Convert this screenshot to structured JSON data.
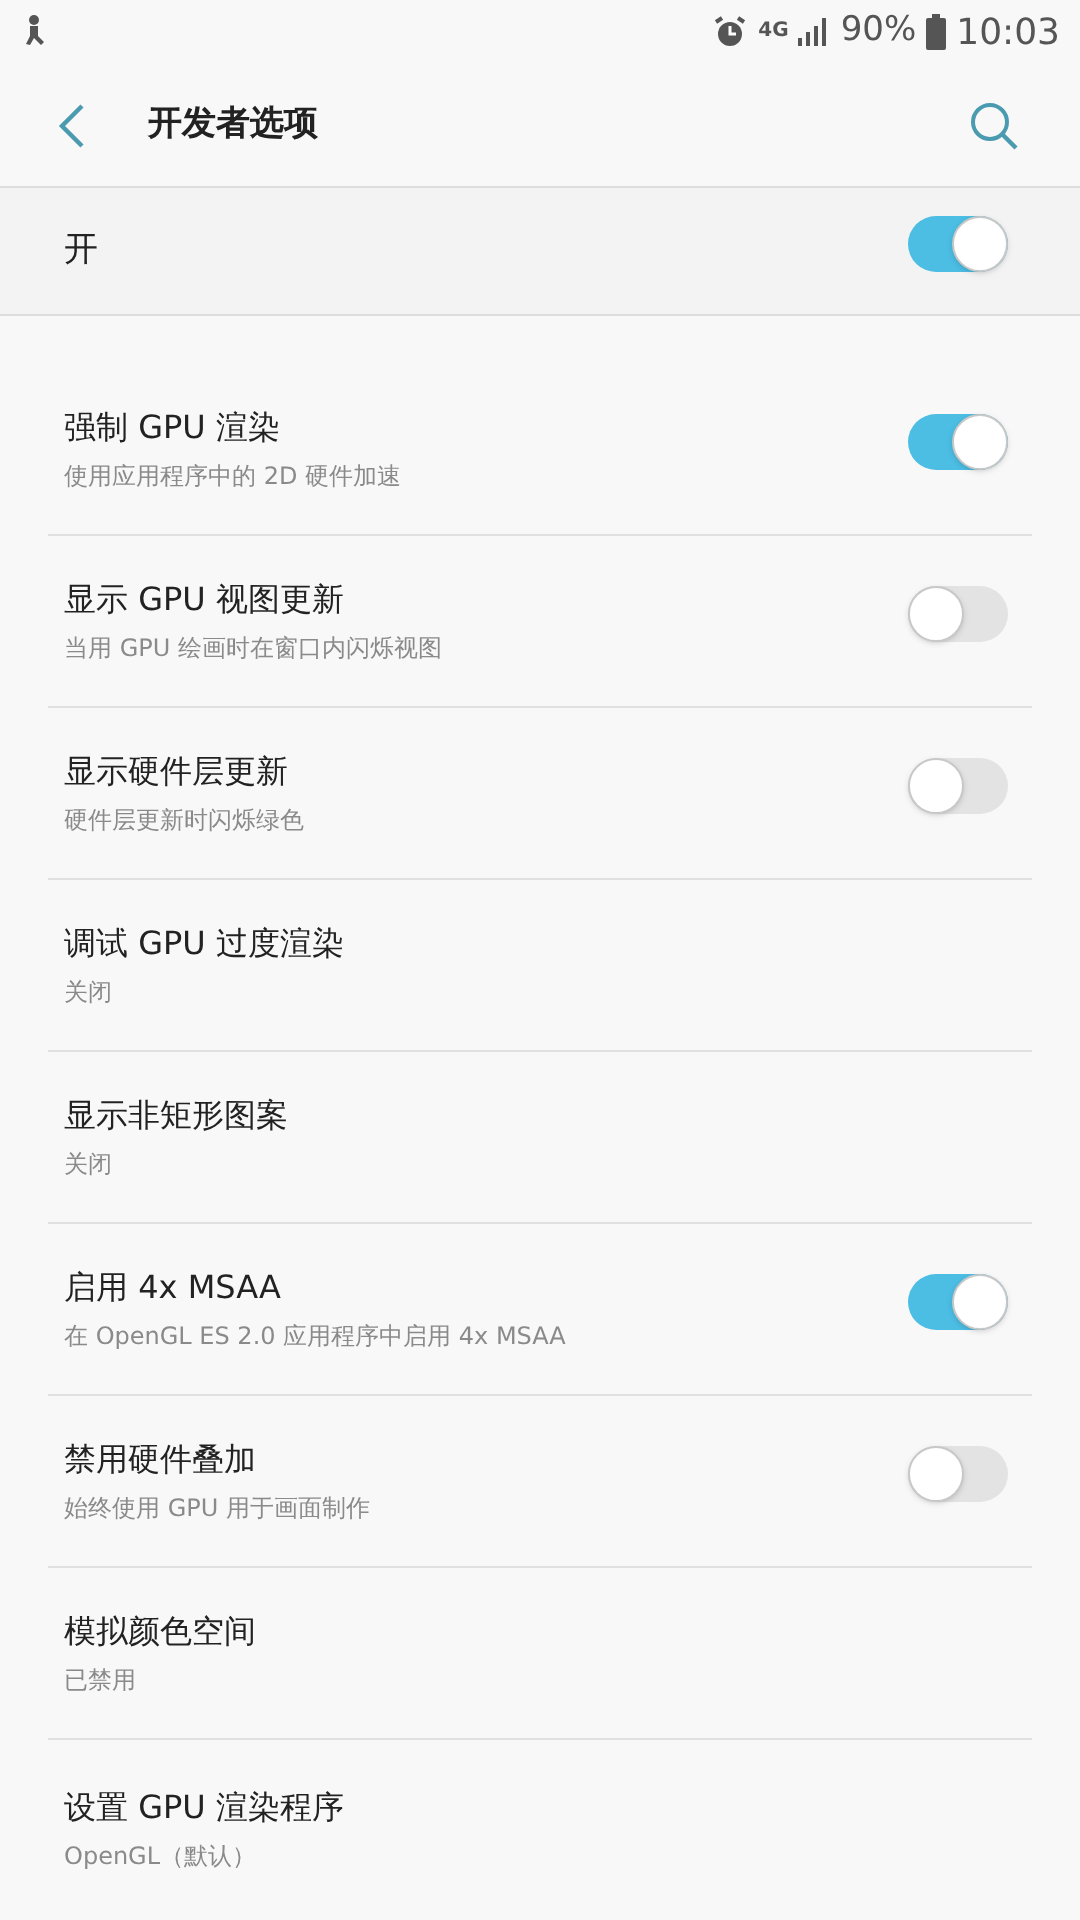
{
  "status_bar": {
    "network": "4G",
    "battery": "90%",
    "time": "10:03"
  },
  "header": {
    "title": "开发者选项"
  },
  "master": {
    "label": "开",
    "on": true
  },
  "items": [
    {
      "kind": "switch",
      "title": "强制 GPU 渲染",
      "subtitle": "使用应用程序中的 2D 硬件加速",
      "on": true
    },
    {
      "kind": "switch",
      "title": "显示 GPU 视图更新",
      "subtitle": "当用 GPU 绘画时在窗口内闪烁视图",
      "on": false
    },
    {
      "kind": "switch",
      "title": "显示硬件层更新",
      "subtitle": "硬件层更新时闪烁绿色",
      "on": false
    },
    {
      "kind": "value",
      "title": "调试 GPU 过度渲染",
      "subtitle": "关闭"
    },
    {
      "kind": "value",
      "title": "显示非矩形图案",
      "subtitle": "关闭"
    },
    {
      "kind": "switch",
      "title": "启用 4x MSAA",
      "subtitle": "在 OpenGL ES 2.0 应用程序中启用 4x MSAA",
      "on": true
    },
    {
      "kind": "switch",
      "title": "禁用硬件叠加",
      "subtitle": "始终使用 GPU 用于画面制作",
      "on": false
    },
    {
      "kind": "value",
      "title": "模拟颜色空间",
      "subtitle": "已禁用"
    },
    {
      "kind": "value",
      "title": "设置 GPU 渲染程序",
      "subtitle": "OpenGL（默认）"
    }
  ]
}
